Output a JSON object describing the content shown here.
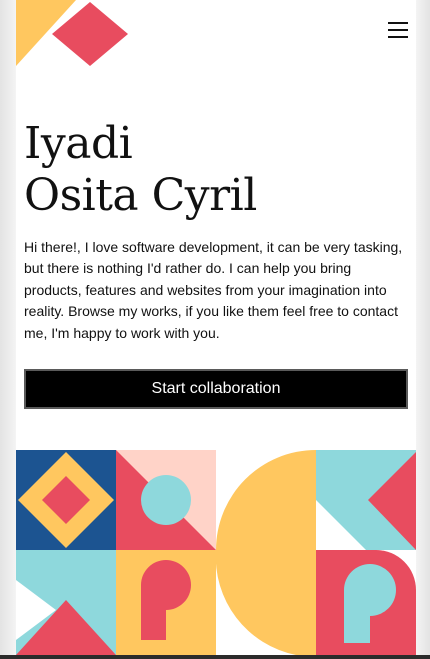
{
  "header": {
    "logo_icon": "geometric-logo-icon",
    "menu_icon": "hamburger-menu-icon"
  },
  "hero": {
    "name_line1": "Iyadi",
    "name_line2": "Osita Cyril",
    "bio": "Hi there!, I love software development, it can be very tasking, but there is nothing I'd rather do. I can help you bring products, features and websites from your imagination into reality. Browse my works, if you like them feel free to contact me, I'm happy to work with you.",
    "cta_label": "Start collaboration"
  },
  "colors": {
    "yellow": "#FFC75F",
    "red": "#E84C5F",
    "blue": "#1C5491",
    "teal": "#8ED8DC",
    "pink": "#FFD3C8",
    "button_bg": "#000000"
  }
}
